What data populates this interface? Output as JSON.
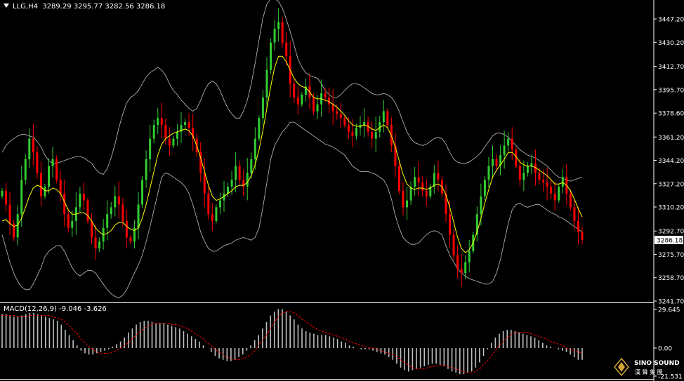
{
  "header": {
    "symbol_tf": "LLG,H4",
    "ohlc": "3289.29 3295.77 3282.56 3286.18"
  },
  "current_price_label": "3286.18",
  "macd_header": {
    "name": "MACD(12,26,9)",
    "values": "-9.046 -3.626"
  },
  "logo": {
    "text": "SINO SOUND",
    "sub": "漢 聲 集 團"
  },
  "colors": {
    "background": "#000000",
    "bull": "#32cd32",
    "bear": "#ff0000",
    "ma": "#ffff00",
    "bands": "#c0c0c0",
    "macd_hist": "#c0c0c0",
    "signal": "#ff0000",
    "axis": "#ffffff"
  },
  "chart_data": [
    {
      "type": "candlestick",
      "title": "LLG,H4",
      "ylim": [
        3241.7,
        3460
      ],
      "y_ticks": [
        "3447.20",
        "3430.20",
        "3412.70",
        "3395.70",
        "3378.60",
        "3361.20",
        "3344.20",
        "3327.20",
        "3310.20",
        "3292.70",
        "3275.70",
        "3258.70",
        "3241.70"
      ],
      "last_price": 3286.18,
      "close": [
        3322,
        3312,
        3298,
        3288,
        3305,
        3330,
        3345,
        3360,
        3350,
        3335,
        3318,
        3325,
        3340,
        3345,
        3330,
        3320,
        3305,
        3295,
        3300,
        3310,
        3320,
        3315,
        3300,
        3288,
        3280,
        3285,
        3295,
        3305,
        3310,
        3318,
        3312,
        3300,
        3288,
        3285,
        3295,
        3312,
        3330,
        3345,
        3360,
        3370,
        3375,
        3370,
        3360,
        3355,
        3360,
        3365,
        3370,
        3372,
        3368,
        3360,
        3350,
        3335,
        3320,
        3305,
        3300,
        3310,
        3315,
        3320,
        3325,
        3330,
        3340,
        3330,
        3325,
        3335,
        3345,
        3360,
        3375,
        3390,
        3410,
        3430,
        3440,
        3445,
        3430,
        3420,
        3400,
        3390,
        3385,
        3392,
        3398,
        3390,
        3380,
        3385,
        3393,
        3390,
        3385,
        3380,
        3378,
        3375,
        3370,
        3365,
        3362,
        3368,
        3370,
        3372,
        3365,
        3360,
        3365,
        3372,
        3380,
        3370,
        3355,
        3340,
        3322,
        3310,
        3315,
        3325,
        3332,
        3328,
        3322,
        3318,
        3325,
        3335,
        3330,
        3320,
        3305,
        3290,
        3275,
        3265,
        3262,
        3270,
        3278,
        3290,
        3305,
        3318,
        3330,
        3340,
        3345,
        3340,
        3348,
        3355,
        3360,
        3352,
        3340,
        3330,
        3335,
        3340,
        3342,
        3335,
        3330,
        3328,
        3325,
        3320,
        3315,
        3325,
        3332,
        3320,
        3310,
        3300,
        3292,
        3286.18
      ],
      "ma": [
        3300,
        3301,
        3298,
        3296,
        3297,
        3302,
        3310,
        3318,
        3324,
        3326,
        3325,
        3322,
        3322,
        3324,
        3323,
        3320,
        3314,
        3308,
        3305,
        3305,
        3306,
        3306,
        3304,
        3300,
        3295,
        3292,
        3290,
        3291,
        3293,
        3297,
        3299,
        3299,
        3296,
        3294,
        3293,
        3295,
        3302,
        3312,
        3324,
        3336,
        3348,
        3356,
        3360,
        3362,
        3364,
        3365,
        3366,
        3367,
        3366,
        3362,
        3355,
        3346,
        3336,
        3326,
        3318,
        3315,
        3316,
        3318,
        3320,
        3322,
        3325,
        3326,
        3326,
        3328,
        3333,
        3341,
        3352,
        3366,
        3382,
        3398,
        3412,
        3420,
        3420,
        3416,
        3410,
        3404,
        3400,
        3398,
        3397,
        3394,
        3390,
        3389,
        3389,
        3388,
        3387,
        3385,
        3383,
        3380,
        3377,
        3373,
        3370,
        3369,
        3369,
        3370,
        3369,
        3367,
        3366,
        3368,
        3370,
        3368,
        3362,
        3354,
        3344,
        3334,
        3327,
        3324,
        3323,
        3324,
        3324,
        3323,
        3324,
        3326,
        3327,
        3325,
        3319,
        3310,
        3299,
        3288,
        3280,
        3277,
        3279,
        3284,
        3292,
        3302,
        3313,
        3323,
        3332,
        3337,
        3341,
        3345,
        3350,
        3350,
        3347,
        3343,
        3341,
        3340,
        3340,
        3339,
        3337,
        3335,
        3333,
        3330,
        3327,
        3327,
        3328,
        3326,
        3322,
        3316,
        3309,
        3303
      ],
      "upper_band": [
        3350,
        3355,
        3358,
        3360,
        3362,
        3363,
        3363,
        3362,
        3361,
        3358,
        3354,
        3348,
        3344,
        3342,
        3342,
        3343,
        3344,
        3345,
        3346,
        3347,
        3347,
        3346,
        3344,
        3342,
        3338,
        3335,
        3334,
        3338,
        3346,
        3356,
        3368,
        3378,
        3386,
        3390,
        3392,
        3395,
        3400,
        3405,
        3408,
        3410,
        3412,
        3410,
        3406,
        3400,
        3395,
        3392,
        3388,
        3385,
        3382,
        3380,
        3382,
        3388,
        3395,
        3400,
        3402,
        3400,
        3395,
        3388,
        3382,
        3378,
        3375,
        3375,
        3380,
        3388,
        3400,
        3415,
        3432,
        3448,
        3458,
        3462,
        3462,
        3460,
        3455,
        3447,
        3438,
        3428,
        3418,
        3412,
        3408,
        3406,
        3405,
        3404,
        3400,
        3395,
        3392,
        3390,
        3390,
        3392,
        3395,
        3398,
        3400,
        3400,
        3399,
        3397,
        3395,
        3393,
        3392,
        3392,
        3393,
        3392,
        3390,
        3386,
        3380,
        3372,
        3365,
        3360,
        3357,
        3356,
        3355,
        3356,
        3358,
        3360,
        3361,
        3360,
        3356,
        3350,
        3345,
        3343,
        3342,
        3342,
        3343,
        3345,
        3347,
        3350,
        3354,
        3358,
        3362,
        3364,
        3364,
        3363,
        3361,
        3358,
        3355,
        3352,
        3350,
        3348,
        3347,
        3346,
        3344,
        3342,
        3340,
        3337,
        3334,
        3332,
        3331,
        3330,
        3329,
        3330,
        3331,
        3332
      ],
      "lower_band": [
        3290,
        3280,
        3270,
        3262,
        3256,
        3252,
        3250,
        3250,
        3254,
        3260,
        3266,
        3274,
        3278,
        3280,
        3282,
        3282,
        3278,
        3272,
        3266,
        3262,
        3260,
        3262,
        3264,
        3264,
        3262,
        3258,
        3254,
        3250,
        3247,
        3245,
        3244,
        3246,
        3250,
        3256,
        3262,
        3268,
        3275,
        3285,
        3296,
        3308,
        3320,
        3332,
        3335,
        3334,
        3332,
        3330,
        3328,
        3325,
        3320,
        3312,
        3302,
        3292,
        3285,
        3280,
        3278,
        3278,
        3280,
        3282,
        3283,
        3284,
        3286,
        3287,
        3288,
        3287,
        3286,
        3288,
        3295,
        3310,
        3328,
        3345,
        3355,
        3360,
        3365,
        3368,
        3372,
        3372,
        3370,
        3368,
        3366,
        3364,
        3362,
        3360,
        3358,
        3356,
        3355,
        3354,
        3352,
        3350,
        3348,
        3344,
        3340,
        3338,
        3336,
        3336,
        3336,
        3335,
        3334,
        3332,
        3330,
        3325,
        3316,
        3304,
        3295,
        3288,
        3285,
        3283,
        3283,
        3284,
        3287,
        3290,
        3292,
        3293,
        3292,
        3290,
        3282,
        3275,
        3270,
        3265,
        3262,
        3260,
        3258,
        3257,
        3256,
        3255,
        3254,
        3254,
        3256,
        3262,
        3272,
        3285,
        3298,
        3308,
        3312,
        3313,
        3311,
        3310,
        3311,
        3312,
        3312,
        3310,
        3308,
        3306,
        3305,
        3303,
        3302,
        3300,
        3298,
        3296,
        3294,
        3292
      ]
    },
    {
      "type": "histogram",
      "title": "MACD(12,26,9)",
      "ylim": [
        -21.531,
        29.645
      ],
      "y_ticks": [
        "29.645",
        "0.00",
        "-21.531"
      ],
      "last_values": [
        -9.046,
        -3.626
      ],
      "macd": [
        26,
        26,
        25,
        24,
        24,
        25,
        26,
        27,
        27,
        26,
        25,
        24,
        23,
        22,
        21,
        18,
        14,
        10,
        6,
        2,
        -2,
        -4,
        -5,
        -5,
        -4,
        -3,
        -2,
        -1,
        1,
        3,
        5,
        8,
        12,
        15,
        18,
        20,
        21,
        21,
        20,
        19,
        19,
        19,
        18,
        17,
        16,
        15,
        13,
        11,
        9,
        7,
        5,
        2,
        0,
        -3,
        -6,
        -8,
        -9,
        -10,
        -10,
        -9,
        -7,
        -5,
        -2,
        2,
        6,
        10,
        15,
        20,
        25,
        28,
        30,
        30,
        28,
        25,
        22,
        18,
        15,
        13,
        12,
        11,
        10,
        10,
        10,
        9,
        8,
        7,
        5,
        4,
        2,
        1,
        0,
        -1,
        -1,
        -1,
        -2,
        -3,
        -4,
        -5,
        -7,
        -9,
        -12,
        -15,
        -17,
        -18,
        -17,
        -16,
        -15,
        -14,
        -13,
        -12,
        -12,
        -13,
        -14,
        -16,
        -18,
        -19,
        -20,
        -20,
        -19,
        -18,
        -15,
        -11,
        -6,
        -1,
        4,
        8,
        11,
        13,
        14,
        14,
        13,
        12,
        11,
        10,
        9,
        8,
        6,
        4,
        2,
        1,
        0,
        -1,
        -2,
        -3,
        -5,
        -7,
        -9,
        -9.046
      ],
      "signal": [
        25,
        25,
        25,
        25,
        24,
        24,
        24,
        25,
        25,
        25,
        25,
        25,
        25,
        24,
        23,
        22,
        20,
        17,
        14,
        11,
        7,
        4,
        1,
        -1,
        -3,
        -4,
        -4,
        -4,
        -3,
        -2,
        0,
        2,
        4,
        7,
        10,
        13,
        15,
        17,
        18,
        19,
        19,
        19,
        19,
        18,
        18,
        17,
        16,
        15,
        13,
        11,
        9,
        7,
        4,
        2,
        -1,
        -3,
        -5,
        -7,
        -8,
        -9,
        -9,
        -8,
        -7,
        -5,
        -2,
        2,
        6,
        10,
        15,
        20,
        24,
        27,
        28,
        28,
        27,
        25,
        22,
        20,
        18,
        16,
        14,
        13,
        12,
        11,
        10,
        9,
        8,
        7,
        5,
        4,
        3,
        2,
        1,
        0,
        0,
        -1,
        -2,
        -3,
        -4,
        -5,
        -7,
        -9,
        -11,
        -13,
        -15,
        -16,
        -16,
        -16,
        -15,
        -14,
        -14,
        -13,
        -13,
        -14,
        -15,
        -16,
        -17,
        -18,
        -19,
        -19,
        -18,
        -16,
        -13,
        -10,
        -6,
        -2,
        2,
        5,
        8,
        10,
        12,
        12,
        12,
        12,
        11,
        10,
        9,
        8,
        7,
        5,
        4,
        3,
        2,
        0,
        -1,
        -2,
        -3,
        -3.626
      ]
    }
  ]
}
